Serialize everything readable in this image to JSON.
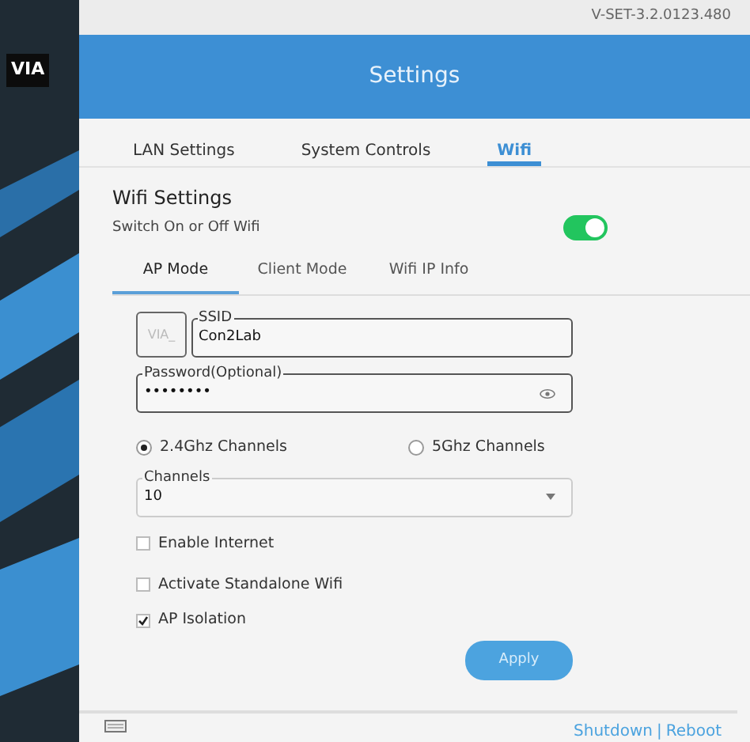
{
  "sidebar": {
    "logo": "VIA"
  },
  "version": "V-SET-3.2.0123.480",
  "header": {
    "title": "Settings"
  },
  "tabs": [
    {
      "label": "LAN Settings",
      "selected": false
    },
    {
      "label": "System Controls",
      "selected": false
    },
    {
      "label": "Wifi",
      "selected": true
    }
  ],
  "wifi_settings": {
    "title": "Wifi Settings",
    "subtitle": "Switch On or Off Wifi",
    "on": true
  },
  "subtabs": [
    {
      "label": "AP Mode",
      "selected": true
    },
    {
      "label": "Client Mode",
      "selected": false
    },
    {
      "label": "Wifi IP Info",
      "selected": false
    }
  ],
  "ssid": {
    "prefix": "VIA_",
    "label": "SSID",
    "value": "Con2Lab"
  },
  "password": {
    "label": "Password(Optional)",
    "value": "••••••••"
  },
  "bands": [
    {
      "label": "2.4Ghz Channels",
      "selected": true
    },
    {
      "label": "5Ghz Channels",
      "selected": false
    }
  ],
  "channels": {
    "label": "Channels",
    "value": "10"
  },
  "options": [
    {
      "label": "Enable Internet",
      "checked": false
    },
    {
      "label": "Activate Standalone Wifi",
      "checked": false
    },
    {
      "label": "AP Isolation",
      "checked": true
    }
  ],
  "apply_button": "Apply",
  "footer": {
    "links": [
      "Shutdown",
      "Reboot"
    ],
    "separator": "|"
  }
}
